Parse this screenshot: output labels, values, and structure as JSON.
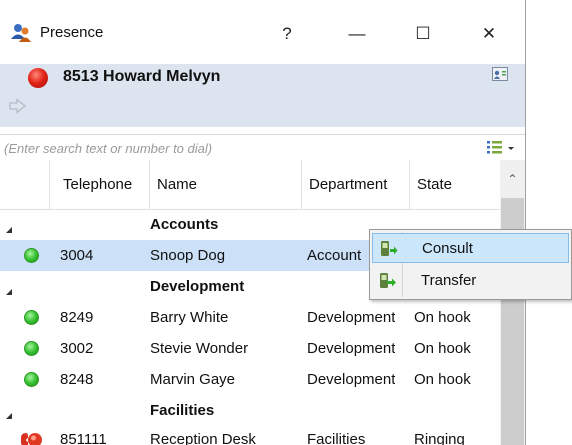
{
  "window": {
    "title": "Presence",
    "help": "?",
    "minimize": "—",
    "maximize": "☐",
    "close": "✕"
  },
  "user": {
    "name": "8513 Howard Melvyn",
    "status_color": "#e3231a"
  },
  "search": {
    "placeholder": "(Enter search text or number to dial)"
  },
  "table": {
    "columns": [
      "Telephone",
      "Name",
      "Department",
      "State"
    ],
    "groups": [
      {
        "label": "Accounts",
        "rows": [
          {
            "telephone": "3004",
            "name": "Snoop Dog",
            "department": "Account",
            "state": "",
            "status": "available",
            "selected": true
          }
        ]
      },
      {
        "label": "Development",
        "rows": [
          {
            "telephone": "8249",
            "name": "Barry White",
            "department": "Development",
            "state": "On hook",
            "status": "available"
          },
          {
            "telephone": "3002",
            "name": "Stevie Wonder",
            "department": "Development",
            "state": "On hook",
            "status": "available"
          },
          {
            "telephone": "8248",
            "name": "Marvin Gaye",
            "department": "Development",
            "state": "On hook",
            "status": "available"
          }
        ]
      },
      {
        "label": "Facilities",
        "rows": [
          {
            "telephone": "851111",
            "name": "Reception Desk",
            "department": "Facilities",
            "state": "Ringing",
            "status": "ringing"
          }
        ]
      }
    ]
  },
  "context_menu": {
    "items": [
      {
        "label": "Consult",
        "icon": "consult-phone-icon",
        "highlighted": true
      },
      {
        "label": "Transfer",
        "icon": "transfer-phone-icon",
        "highlighted": false
      }
    ]
  },
  "colors": {
    "selection": "#cce0f7",
    "user_band": "#dce4ef",
    "available": "#38c232",
    "menu_highlight": "#cce6fb"
  }
}
